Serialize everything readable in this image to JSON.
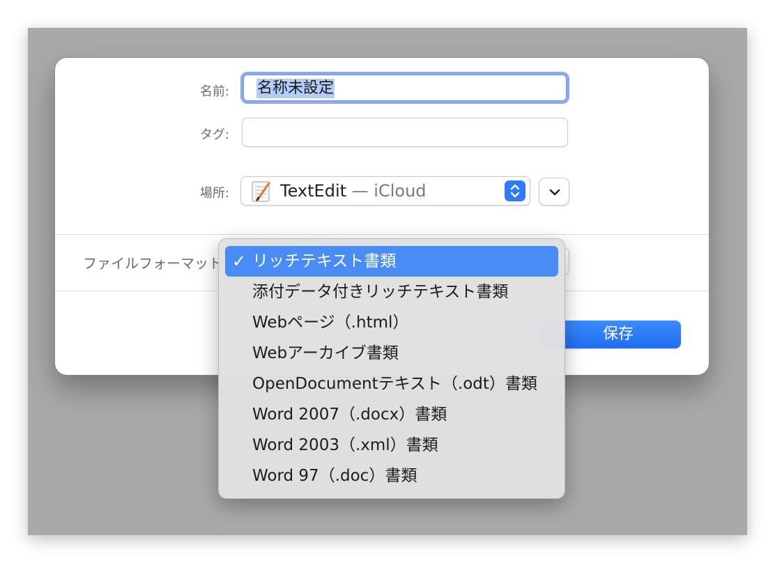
{
  "dialog": {
    "name_label": "名前:",
    "name_value": "名称未設定",
    "tags_label": "タグ:",
    "tags_value": "",
    "where_label": "場所:",
    "where_app": "TextEdit",
    "where_location": "— iCloud",
    "file_format_label": "ファイルフォーマット:",
    "save_label": "保存"
  },
  "format_menu": {
    "items": [
      {
        "label": "リッチテキスト書類",
        "selected": true
      },
      {
        "label": "添付データ付きリッチテキスト書類",
        "selected": false
      },
      {
        "label": "Webページ（.html）",
        "selected": false
      },
      {
        "label": "Webアーカイブ書類",
        "selected": false
      },
      {
        "label": "OpenDocumentテキスト（.odt）書類",
        "selected": false
      },
      {
        "label": "Word 2007（.docx）書類",
        "selected": false
      },
      {
        "label": "Word 2003（.xml）書類",
        "selected": false
      },
      {
        "label": "Word 97（.doc）書類",
        "selected": false
      }
    ]
  },
  "colors": {
    "accent": "#2f7bf6",
    "selection": "#4a8cf5",
    "text_highlight": "#b3cdf8"
  }
}
